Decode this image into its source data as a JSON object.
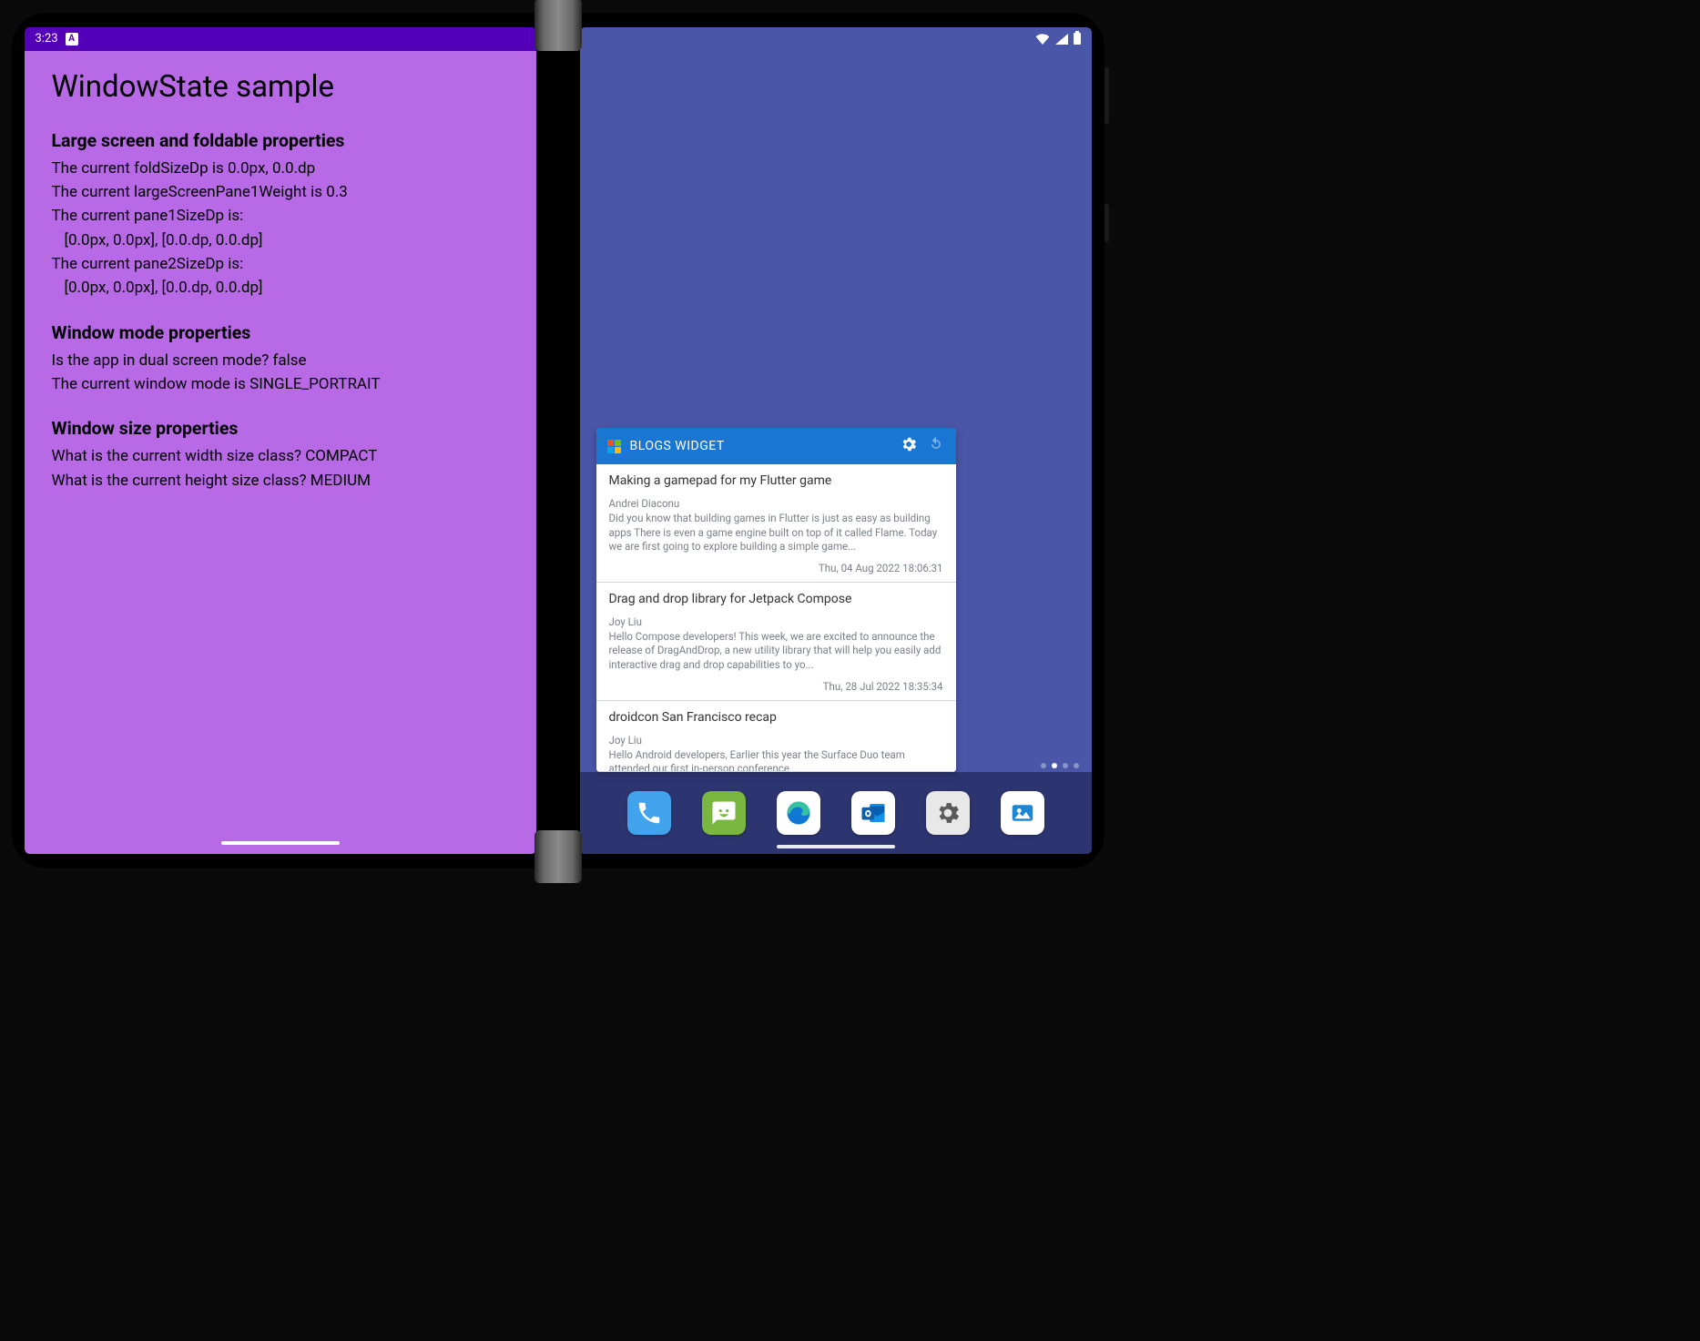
{
  "status_left": {
    "time": "3:23",
    "icon_letter": "A"
  },
  "left": {
    "title": "WindowState sample",
    "s1": {
      "heading": "Large screen and foldable properties",
      "l1": "The current foldSizeDp is 0.0px, 0.0.dp",
      "l2": "The current largeScreenPane1Weight is 0.3",
      "l3a": "The current pane1SizeDp is:",
      "l3b": "[0.0px, 0.0px], [0.0.dp, 0.0.dp]",
      "l4a": "The current pane2SizeDp is:",
      "l4b": "[0.0px, 0.0px], [0.0.dp, 0.0.dp]"
    },
    "s2": {
      "heading": "Window mode properties",
      "l1": "Is the app in dual screen mode? false",
      "l2": "The current window mode is SINGLE_PORTRAIT"
    },
    "s3": {
      "heading": "Window size properties",
      "l1": "What is the current width size class? COMPACT",
      "l2": "What is the current height size class? MEDIUM"
    }
  },
  "widget": {
    "title": "BLOGS WIDGET",
    "posts": [
      {
        "title": "Making a gamepad for my Flutter game",
        "author": "Andrei Diaconu",
        "body": "Did you know that building games in Flutter is just as easy as building apps There is even a game engine built on top of it called Flame. Today we are first going to explore building a simple game...",
        "date": "Thu, 04 Aug 2022 18:06:31"
      },
      {
        "title": "Drag and drop library for Jetpack Compose",
        "author": "Joy Liu",
        "body": "Hello Compose developers!\nThis week, we are excited to announce the release of DragAndDrop, a new utility library that will help you easily add interactive drag and drop capabilities to yo...",
        "date": "Thu, 28 Jul 2022 18:35:34"
      },
      {
        "title": "droidcon San Francisco recap",
        "author": "Joy Liu",
        "body": "Hello Android developers,\nEarlier this year the Surface Duo team attended our first in-person conference",
        "date": ""
      }
    ]
  },
  "dock": {
    "apps": [
      "phone",
      "messages",
      "edge",
      "outlook",
      "settings",
      "photos"
    ]
  },
  "pager": {
    "count": 4,
    "active": 1
  }
}
